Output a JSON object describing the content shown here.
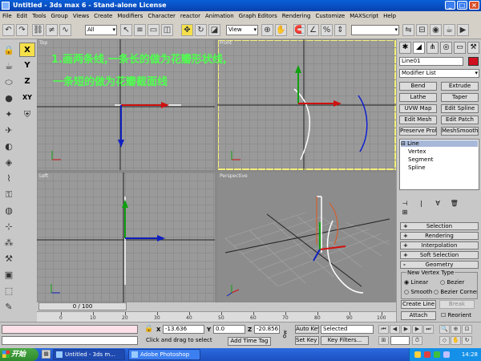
{
  "window": {
    "title": "Untitled - 3ds max 6 - Stand-alone License"
  },
  "menu": [
    "File",
    "Edit",
    "Tools",
    "Group",
    "Views",
    "Create",
    "Modifiers",
    "Character",
    "reactor",
    "Animation",
    "Graph Editors",
    "Rendering",
    "Customize",
    "MAXScript",
    "Help"
  ],
  "toolbar": {
    "selection_filter": "All",
    "ref_coord": "View"
  },
  "axis_constraints": [
    "X",
    "Y",
    "Z",
    "XY"
  ],
  "viewports": {
    "top_label": "Top",
    "front_label": "Front",
    "left_label": "Left",
    "perspective_label": "Perspective",
    "annotation_line1": "1.画两条线,一条长的做为花瓣形状线,",
    "annotation_line2": "一条短的做为花瓣截面线"
  },
  "command_panel": {
    "object_name": "Line01",
    "object_color": "#d0101e",
    "modifier_list": "Modifier List",
    "buttons": [
      "Bend",
      "Extrude",
      "Lathe",
      "Taper",
      "UVW Map",
      "Edit Spline",
      "Edit Mesh",
      "Edit Patch",
      "Preserve Profile",
      "MeshSmooth"
    ],
    "stack": {
      "root": "Line",
      "items": [
        "Vertex",
        "Segment",
        "Spline"
      ]
    },
    "rollouts": [
      {
        "sign": "+",
        "label": "Selection"
      },
      {
        "sign": "+",
        "label": "Rendering"
      },
      {
        "sign": "+",
        "label": "Interpolation"
      },
      {
        "sign": "+",
        "label": "Soft Selection"
      },
      {
        "sign": "-",
        "label": "Geometry"
      }
    ],
    "vertex_group_title": "New Vertex Type",
    "radio_linear": "Linear",
    "radio_bezier": "Bezier",
    "radio_smooth": "Smooth",
    "radio_bezier_corner": "Bezier Corner",
    "create_line": "Create Line",
    "break": "Break",
    "attach": "Attach",
    "reorient": "Reorient"
  },
  "time": {
    "slider": "0 / 100",
    "ticks": [
      "0",
      "10",
      "20",
      "30",
      "40",
      "50",
      "60",
      "70",
      "80",
      "90",
      "100"
    ]
  },
  "status": {
    "x_label": "X",
    "x_value": "-13.636",
    "y_label": "Y",
    "y_value": "0.0",
    "z_label": "Z",
    "z_value": "-20.856",
    "prompt": "Click and drag to select",
    "add_time_tag": "Add Time Tag",
    "auto_key": "Auto Key",
    "selected": "Selected",
    "set_key": "Set Key",
    "key_filters": "Key Filters..."
  },
  "taskbar": {
    "start": "开始",
    "tasks": [
      "Untitled - 3ds m...",
      "Adobe Photoshop"
    ],
    "clock": "14:28"
  }
}
